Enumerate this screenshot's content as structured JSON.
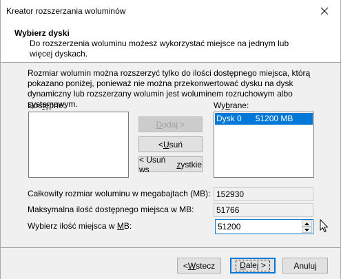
{
  "window": {
    "title": "Kreator rozszerzania woluminów"
  },
  "header": {
    "title": "Wybierz dyski",
    "subtitle": "Do rozszerzenia woluminu możesz wykorzystać miejsce na jednym lub więcej dyskach."
  },
  "description": "Rozmiar wolumin można rozszerzyć tylko do ilości dostępnego miejsca, którą pokazano poniżej, ponieważ nie można przekonwertować dysku na dysk dynamiczny lub rozszerzany wolumin jest woluminem rozruchowym albo systemowym.",
  "available": {
    "label_pre": "Dos",
    "label_key": "t",
    "label_post": "ępne:",
    "items": []
  },
  "selected": {
    "label_pre": "Wy",
    "label_key": "b",
    "label_post": "rane:",
    "items": [
      {
        "disk": "Dysk 0",
        "size": "51200 MB"
      }
    ]
  },
  "buttons": {
    "add": {
      "pre": "",
      "key": "D",
      "post": "odaj >"
    },
    "remove": {
      "pre": "< ",
      "key": "U",
      "post": "suń"
    },
    "remove_all": {
      "pre": "< Usuń ws",
      "key": "z",
      "post": "ystkie"
    },
    "back": {
      "pre": "< ",
      "key": "W",
      "post": "stecz"
    },
    "next": {
      "pre": "",
      "key": "D",
      "post": "alej >"
    },
    "cancel": "Anuluj"
  },
  "fields": {
    "total_label": "Całkowity rozmiar woluminu w megabajtach (MB):",
    "total_value": "152930",
    "max_label": "Maksymalna ilość dostępnego miejsca w MB:",
    "max_value": "51766",
    "choose_label_pre": "Wybierz ilość miejsca w ",
    "choose_label_key": "M",
    "choose_label_post": "B:",
    "choose_value": "51200"
  }
}
